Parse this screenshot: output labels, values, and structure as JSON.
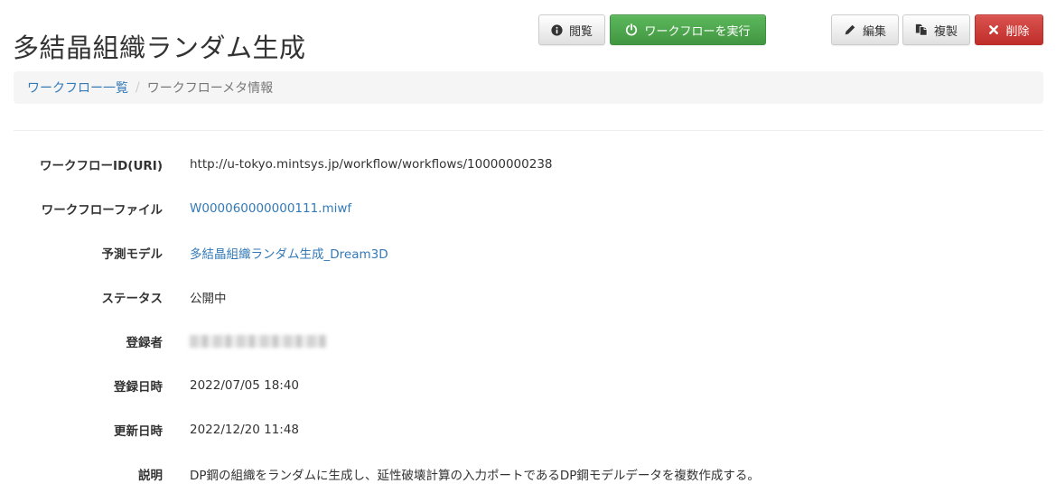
{
  "page": {
    "title": "多結晶組織ランダム生成"
  },
  "toolbar": {
    "view_label": "閲覧",
    "run_label": "ワークフローを実行",
    "edit_label": "編集",
    "copy_label": "複製",
    "delete_label": "削除"
  },
  "breadcrumb": {
    "items": [
      {
        "label": "ワークフロー一覧",
        "link": true
      },
      {
        "label": "ワークフローメタ情報",
        "link": false
      }
    ],
    "separator": "/"
  },
  "details": {
    "rows": [
      {
        "label": "ワークフローID(URI)",
        "value": "http://u-tokyo.mintsys.jp/workflow/workflows/10000000238"
      },
      {
        "label": "ワークフローファイル",
        "value": "W000060000000111.miwf"
      },
      {
        "label": "予測モデル",
        "value": "多結晶組織ランダム生成_Dream3D"
      },
      {
        "label": "ステータス",
        "value": "公開中"
      },
      {
        "label": "登録者",
        "value": ""
      },
      {
        "label": "登録日時",
        "value": "2022/07/05 18:40"
      },
      {
        "label": "更新日時",
        "value": "2022/12/20 11:48"
      },
      {
        "label": "説明",
        "value": "DP鋼の組織をランダムに生成し、延性破壊計算の入力ポートであるDP鋼モデルデータを複数作成する。"
      }
    ]
  },
  "icons": {
    "view": "info-circle-icon",
    "run": "power-icon",
    "edit": "pencil-icon",
    "copy": "copy-icon",
    "delete": "close-icon"
  },
  "colors": {
    "success": "#5cb85c",
    "danger": "#d9534f",
    "link": "#337ab7",
    "breadcrumb_bg": "#f5f5f5"
  }
}
